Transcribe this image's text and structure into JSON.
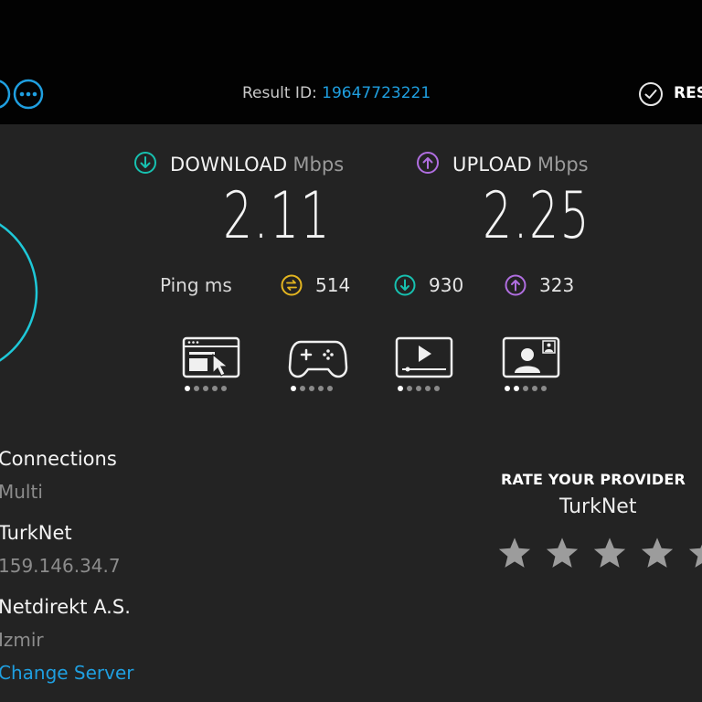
{
  "header": {
    "result_label": "Result ID: ",
    "result_id": "19647723221",
    "results_label": "RESULTS"
  },
  "download": {
    "label": "DOWNLOAD",
    "unit": "Mbps",
    "value": "2.11"
  },
  "upload": {
    "label": "UPLOAD",
    "unit": "Mbps",
    "value": "2.25"
  },
  "ping": {
    "label": "Ping ms",
    "idle": "514",
    "download": "930",
    "upload": "323"
  },
  "activities": [
    {
      "name": "web-browsing",
      "rating": 1,
      "max": 5
    },
    {
      "name": "gaming",
      "rating": 1,
      "max": 5
    },
    {
      "name": "video-streaming",
      "rating": 1,
      "max": 5
    },
    {
      "name": "video-chat",
      "rating": 2,
      "max": 5
    }
  ],
  "info": {
    "connections_title": "Connections",
    "connections_value": "Multi",
    "isp_name": "TurkNet",
    "isp_ip": "159.146.34.7",
    "server_name": "Netdirekt A.S.",
    "server_city": "Izmir",
    "change_server": "Change Server"
  },
  "rate": {
    "title": "RATE YOUR PROVIDER",
    "provider": "TurkNet",
    "stars": 5
  },
  "colors": {
    "accent_blue": "#1f9fe0",
    "download_teal": "#17c1b0",
    "upload_purple": "#b06ee0",
    "ping_yellow": "#e3b520",
    "gauge_cyan": "#1ec8d8",
    "background": "#232323",
    "topbar": "#020202"
  }
}
